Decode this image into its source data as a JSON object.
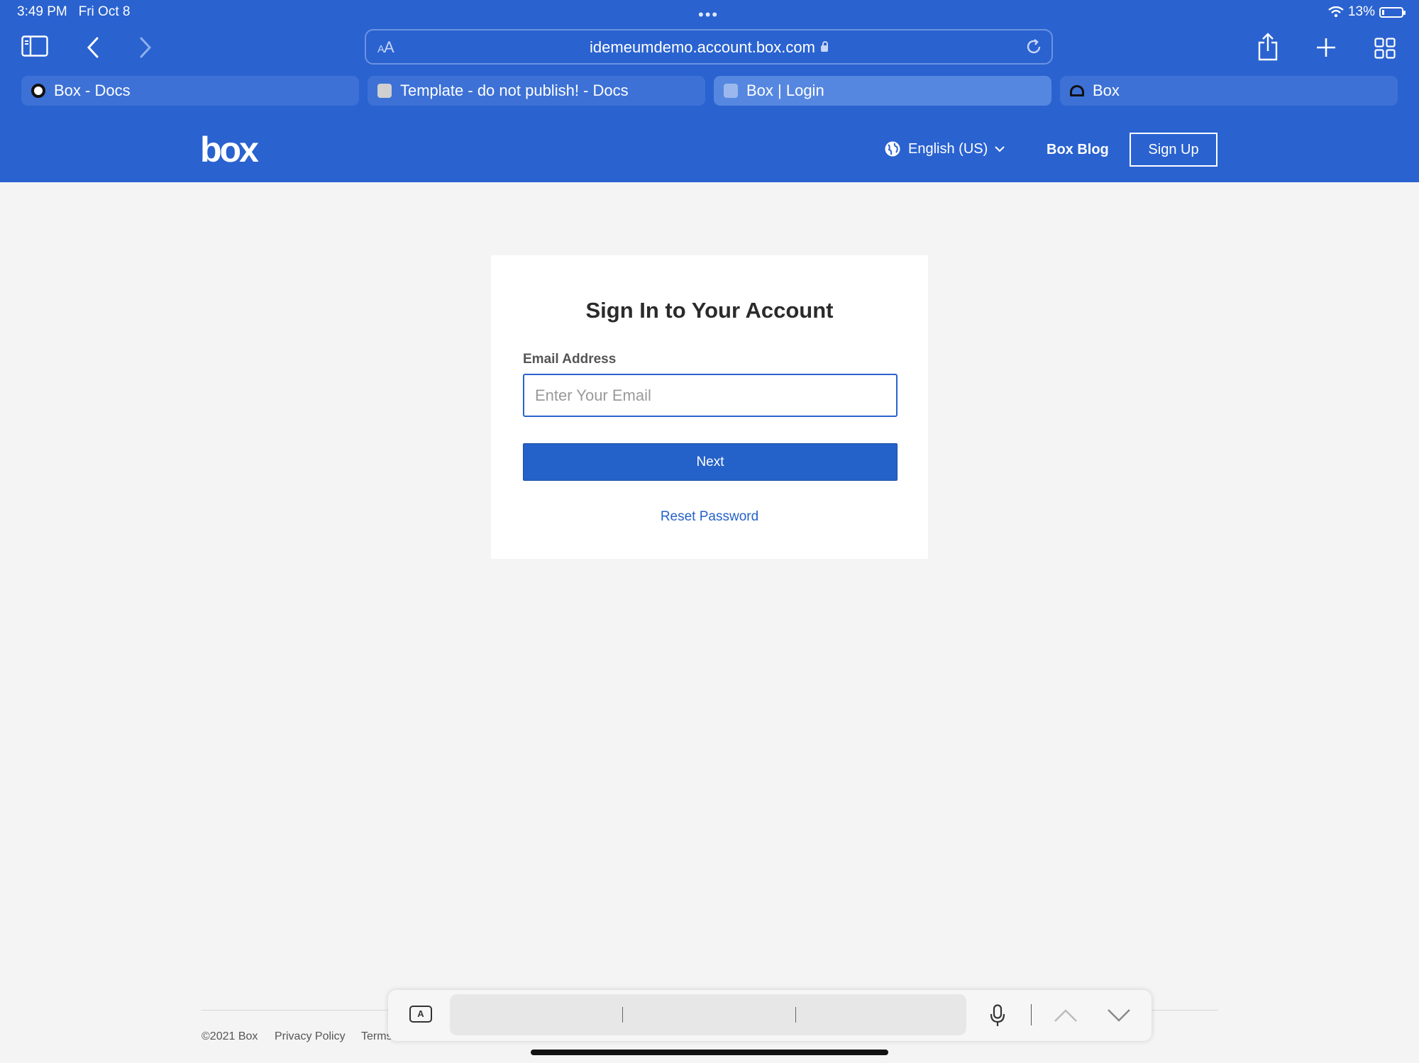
{
  "status": {
    "time": "3:49 PM",
    "date": "Fri Oct 8",
    "battery": "13%"
  },
  "toolbar": {
    "aa_label": "AA",
    "url": "idemeumdemo.account.box.com"
  },
  "tabs": [
    {
      "title": "Box - Docs",
      "favicon": "circle-icon",
      "active": false
    },
    {
      "title": "Template - do not publish! - Docs",
      "favicon": "doc-icon",
      "active": false
    },
    {
      "title": "Box | Login",
      "favicon": "box-icon",
      "active": true
    },
    {
      "title": "Box",
      "favicon": "dome-icon",
      "active": false
    }
  ],
  "header": {
    "logo": "box",
    "language": "English (US)",
    "blog": "Box Blog",
    "signup": "Sign Up"
  },
  "login": {
    "title": "Sign In to Your Account",
    "email_label": "Email Address",
    "email_placeholder": "Enter Your Email",
    "email_value": "",
    "next": "Next",
    "reset": "Reset Password"
  },
  "footer": {
    "copyright": "©2021 Box",
    "privacy": "Privacy Policy",
    "terms": "Terms"
  },
  "colors": {
    "brand": "#2a62d0",
    "button": "#2461c9",
    "page_bg": "#f4f4f4"
  }
}
